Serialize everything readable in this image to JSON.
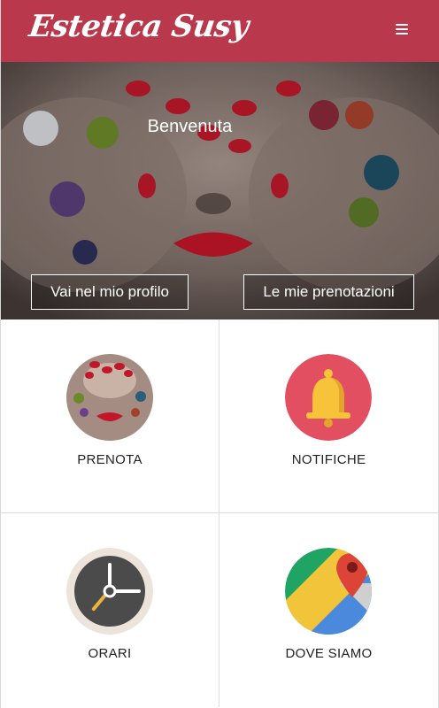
{
  "header": {
    "brand": "Estetica Susy",
    "menu_icon": "hamburger-icon"
  },
  "hero": {
    "greeting": "Benvenuta",
    "profile_button": "Vai nel mio profilo",
    "bookings_button": "Le mie prenotazioni"
  },
  "tiles": [
    {
      "label": "PRENOTA",
      "icon": "nails-photo-icon"
    },
    {
      "label": "NOTIFICHE",
      "icon": "bell-icon"
    },
    {
      "label": "ORARI",
      "icon": "clock-icon"
    },
    {
      "label": "DOVE SIAMO",
      "icon": "map-pin-icon"
    }
  ],
  "colors": {
    "brand": "#b9384c",
    "bell_bg": "#e14f61",
    "bell": "#f6c33b"
  }
}
